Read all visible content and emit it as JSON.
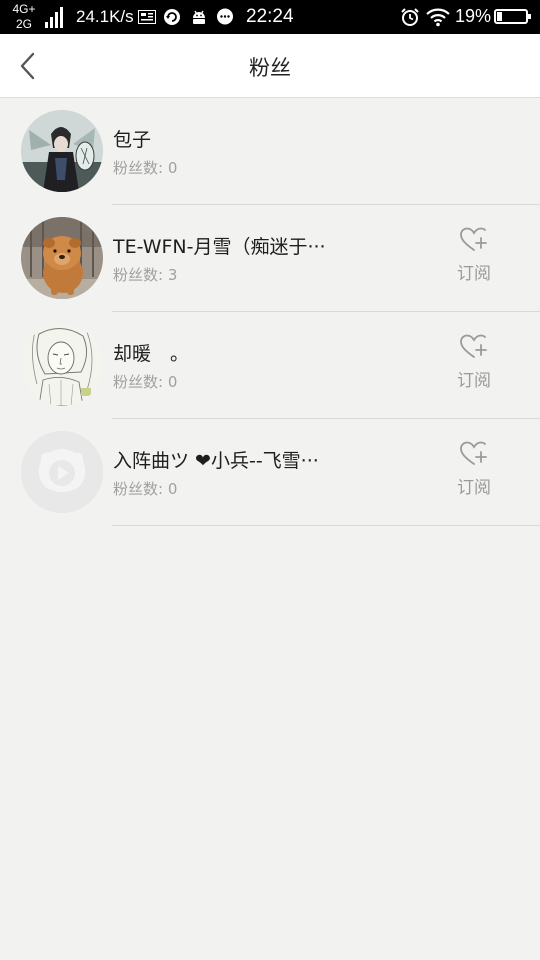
{
  "status_bar": {
    "network_top": "4G+",
    "network_bottom": "2G",
    "speed": "24.1K/s",
    "time": "22:24",
    "battery_text": "19%",
    "battery_level": 0.19
  },
  "header": {
    "title": "粉丝"
  },
  "fans": [
    {
      "name": "包子",
      "fans_label": "粉丝数: 0",
      "has_subscribe": false,
      "subscribe_label": ""
    },
    {
      "name": "TE-WFN-月雪（痴迷于···",
      "fans_label": "粉丝数: 3",
      "has_subscribe": true,
      "subscribe_label": "订阅"
    },
    {
      "name": "却暖　。",
      "fans_label": "粉丝数: 0",
      "has_subscribe": true,
      "subscribe_label": "订阅"
    },
    {
      "name": "入阵曲ツ ❤小兵--飞雪···",
      "fans_label": "粉丝数: 0",
      "has_subscribe": true,
      "subscribe_label": "订阅"
    }
  ],
  "colors": {
    "background": "#f2f2f0",
    "header_bg": "#ffffff",
    "secondary_text": "#a0a0a0"
  }
}
